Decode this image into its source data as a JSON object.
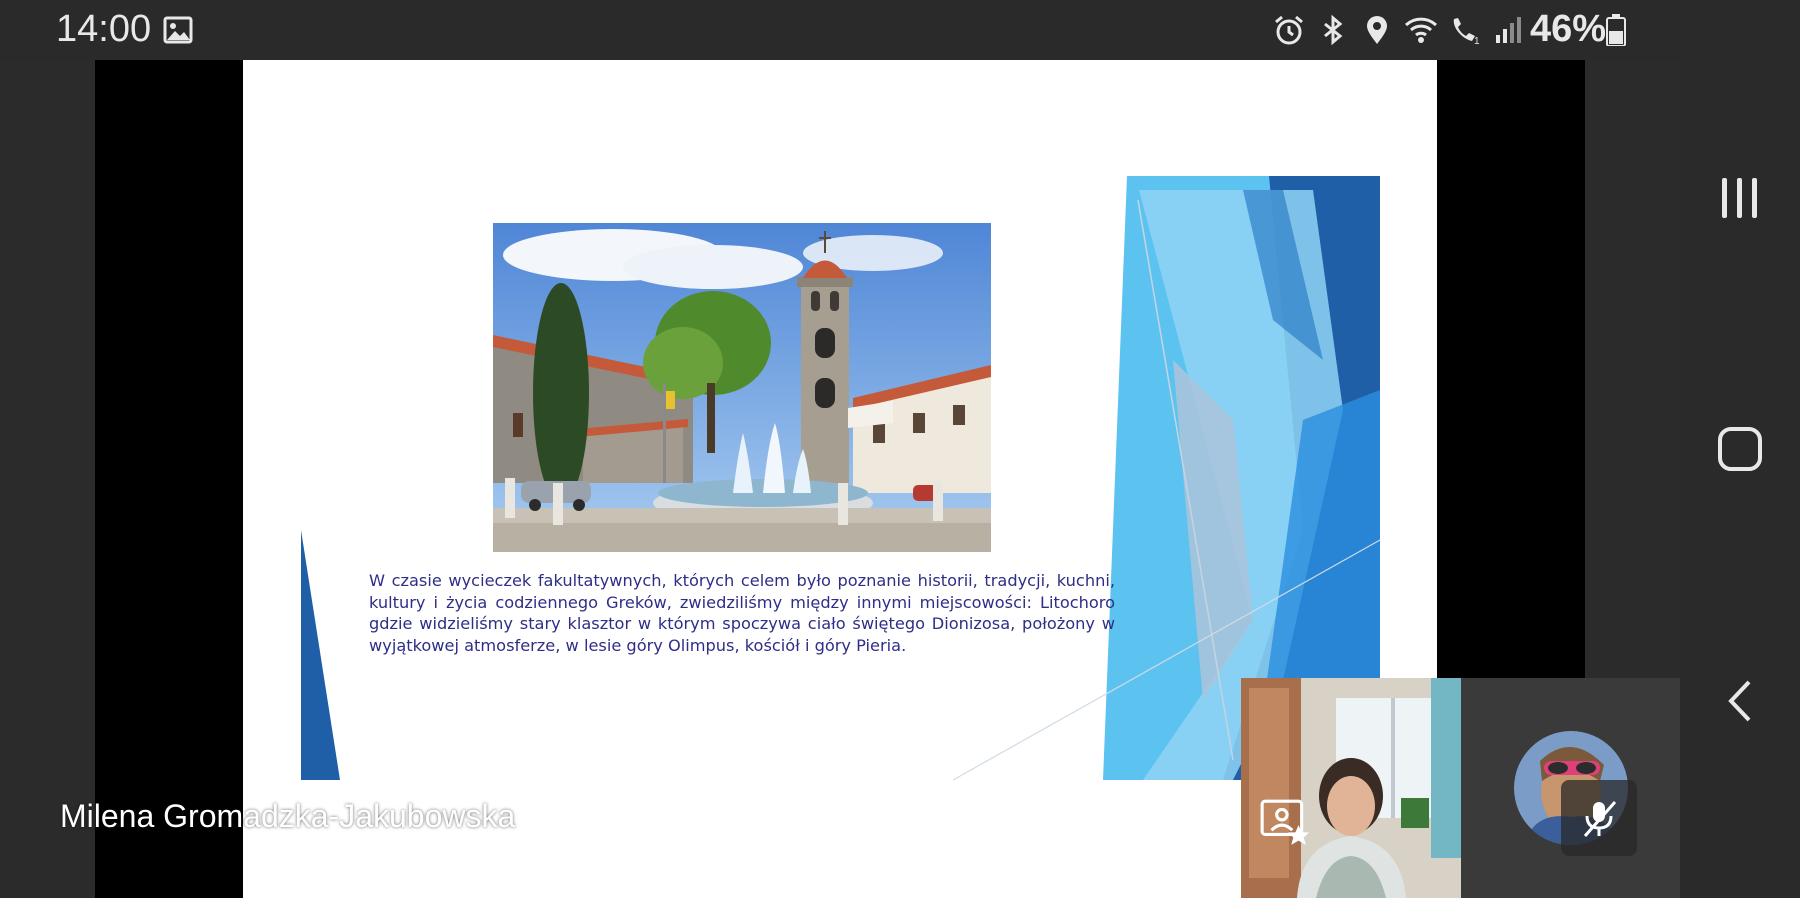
{
  "status_bar": {
    "time": "14:00",
    "battery": "46%",
    "icons": [
      "gallery-icon",
      "alarm-icon",
      "bluetooth-icon",
      "location-icon",
      "wifi-icon",
      "wifi-calling-icon",
      "signal-icon",
      "battery-icon"
    ]
  },
  "slide": {
    "body_text": "W czasie wycieczek fakultatywnych, których celem było poznanie historii, tradycji, kuchni, kultury i życia codziennego Greków, zwiedziliśmy między innymi miejscowości: Litochoro gdzie widzieliśmy stary klasztor w którym spoczywa ciało świętego Dionizosa, położony w wyjątkowej atmosferze, w lesie góry Olimpus, kościół i góry Pieria.",
    "photo": "town-square-church-bell-tower-photo",
    "accent_colors": [
      "#1f5fa8",
      "#2a8ee0",
      "#5cc3f0",
      "#a9c4dc"
    ]
  },
  "call": {
    "presenter_name": "Milena Gromadzka-Jakubowska",
    "self_tile_icon": "present-screen-icon",
    "avatar_tile_icon": "mic-off-icon"
  },
  "nav": {
    "buttons": [
      "recents-icon",
      "home-icon",
      "back-icon"
    ]
  }
}
